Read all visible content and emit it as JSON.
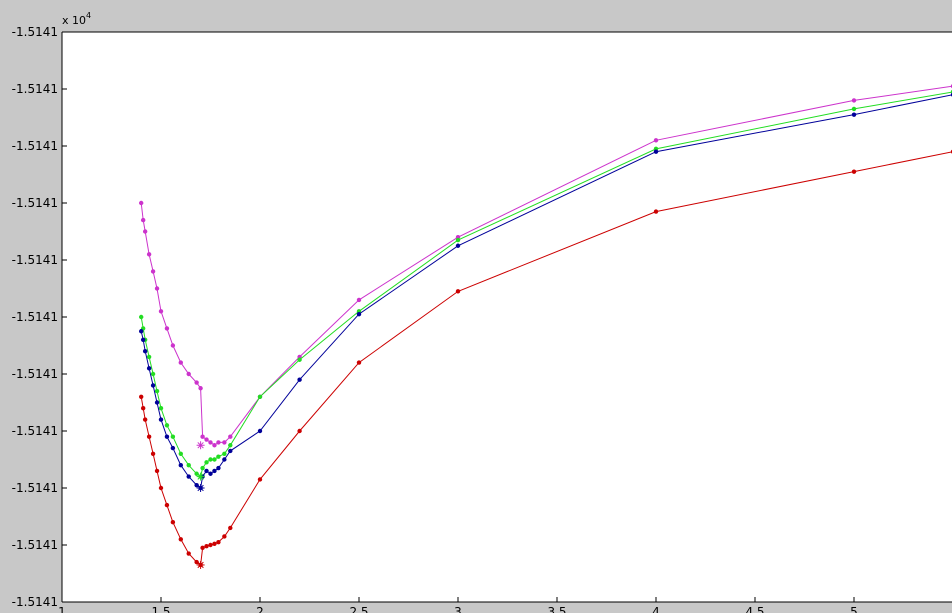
{
  "chart_data": {
    "type": "line",
    "title": "",
    "xlabel": "",
    "ylabel": "",
    "y_multiplier_label": {
      "base": "x 10",
      "exponent": "4"
    },
    "xlim": [
      1,
      5.5
    ],
    "ylim": [
      0,
      10
    ],
    "x_ticks": [
      1,
      1.5,
      2,
      2.5,
      3,
      3.5,
      4,
      4.5,
      5
    ],
    "x_tick_labels": [
      "1",
      "1.5",
      "2",
      "2.5",
      "3",
      "3.5",
      "4",
      "4.5",
      "5"
    ],
    "y_ticks": [
      0,
      1,
      2,
      3,
      4,
      5,
      6,
      7,
      8,
      9,
      10
    ],
    "y_tick_labels": [
      "-1.5141",
      "-1.5141",
      "-1.5141",
      "-1.5141",
      "-1.5141",
      "-1.5141",
      "-1.5141",
      "-1.5141",
      "-1.5141",
      "-1.5141",
      "-1.5141"
    ],
    "grid": false,
    "series": [
      {
        "color": "#cc33cc",
        "marker": "dot",
        "points": [
          [
            1.4,
            7.0
          ],
          [
            1.41,
            6.7
          ],
          [
            1.42,
            6.5
          ],
          [
            1.44,
            6.1
          ],
          [
            1.46,
            5.8
          ],
          [
            1.48,
            5.5
          ],
          [
            1.5,
            5.1
          ],
          [
            1.53,
            4.8
          ],
          [
            1.56,
            4.5
          ],
          [
            1.6,
            4.2
          ],
          [
            1.64,
            4.0
          ],
          [
            1.68,
            3.85
          ],
          [
            1.7,
            3.75
          ],
          [
            1.71,
            2.9
          ],
          [
            1.73,
            2.85
          ],
          [
            1.75,
            2.8
          ],
          [
            1.77,
            2.75
          ],
          [
            1.79,
            2.8
          ],
          [
            1.82,
            2.8
          ],
          [
            1.85,
            2.9
          ],
          [
            2.0,
            3.6
          ],
          [
            2.2,
            4.3
          ],
          [
            2.5,
            5.3
          ],
          [
            3.0,
            6.4
          ],
          [
            4.0,
            8.1
          ],
          [
            5.0,
            8.8
          ],
          [
            5.5,
            9.05
          ]
        ]
      },
      {
        "color": "#22dd22",
        "marker": "dot",
        "points": [
          [
            1.4,
            5.0
          ],
          [
            1.41,
            4.8
          ],
          [
            1.42,
            4.6
          ],
          [
            1.44,
            4.3
          ],
          [
            1.46,
            4.0
          ],
          [
            1.48,
            3.7
          ],
          [
            1.5,
            3.4
          ],
          [
            1.53,
            3.1
          ],
          [
            1.56,
            2.9
          ],
          [
            1.6,
            2.6
          ],
          [
            1.64,
            2.4
          ],
          [
            1.68,
            2.25
          ],
          [
            1.7,
            2.2
          ],
          [
            1.71,
            2.35
          ],
          [
            1.73,
            2.45
          ],
          [
            1.75,
            2.5
          ],
          [
            1.77,
            2.5
          ],
          [
            1.79,
            2.55
          ],
          [
            1.82,
            2.6
          ],
          [
            1.85,
            2.75
          ],
          [
            2.0,
            3.6
          ],
          [
            2.2,
            4.25
          ],
          [
            2.5,
            5.1
          ],
          [
            3.0,
            6.35
          ],
          [
            4.0,
            7.95
          ],
          [
            5.0,
            8.65
          ],
          [
            5.5,
            8.95
          ]
        ]
      },
      {
        "color": "#000099",
        "marker": "dot",
        "points": [
          [
            1.4,
            4.75
          ],
          [
            1.41,
            4.6
          ],
          [
            1.42,
            4.4
          ],
          [
            1.44,
            4.1
          ],
          [
            1.46,
            3.8
          ],
          [
            1.48,
            3.5
          ],
          [
            1.5,
            3.2
          ],
          [
            1.53,
            2.9
          ],
          [
            1.56,
            2.7
          ],
          [
            1.6,
            2.4
          ],
          [
            1.64,
            2.2
          ],
          [
            1.68,
            2.05
          ],
          [
            1.7,
            2.0
          ],
          [
            1.71,
            2.2
          ],
          [
            1.73,
            2.3
          ],
          [
            1.75,
            2.25
          ],
          [
            1.77,
            2.3
          ],
          [
            1.79,
            2.35
          ],
          [
            1.82,
            2.5
          ],
          [
            1.85,
            2.65
          ],
          [
            2.0,
            3.0
          ],
          [
            2.2,
            3.9
          ],
          [
            2.5,
            5.05
          ],
          [
            3.0,
            6.25
          ],
          [
            4.0,
            7.9
          ],
          [
            5.0,
            8.55
          ],
          [
            5.5,
            8.9
          ]
        ]
      },
      {
        "color": "#cc0000",
        "marker": "dot",
        "points": [
          [
            1.4,
            3.6
          ],
          [
            1.41,
            3.4
          ],
          [
            1.42,
            3.2
          ],
          [
            1.44,
            2.9
          ],
          [
            1.46,
            2.6
          ],
          [
            1.48,
            2.3
          ],
          [
            1.5,
            2.0
          ],
          [
            1.53,
            1.7
          ],
          [
            1.56,
            1.4
          ],
          [
            1.6,
            1.1
          ],
          [
            1.64,
            0.85
          ],
          [
            1.68,
            0.7
          ],
          [
            1.7,
            0.65
          ],
          [
            1.71,
            0.95
          ],
          [
            1.73,
            0.98
          ],
          [
            1.75,
            1.0
          ],
          [
            1.77,
            1.02
          ],
          [
            1.79,
            1.05
          ],
          [
            1.82,
            1.15
          ],
          [
            1.85,
            1.3
          ],
          [
            2.0,
            2.15
          ],
          [
            2.2,
            3.0
          ],
          [
            2.5,
            4.2
          ],
          [
            3.0,
            5.45
          ],
          [
            4.0,
            6.85
          ],
          [
            5.0,
            7.55
          ],
          [
            5.5,
            7.9
          ]
        ]
      }
    ],
    "minimum_markers": [
      {
        "color": "#cc33cc",
        "x": 1.7,
        "y": 2.75
      },
      {
        "color": "#22dd22",
        "x": 1.7,
        "y": 2.2
      },
      {
        "color": "#000099",
        "x": 1.7,
        "y": 2.0
      },
      {
        "color": "#cc0000",
        "x": 1.7,
        "y": 0.65
      }
    ]
  }
}
